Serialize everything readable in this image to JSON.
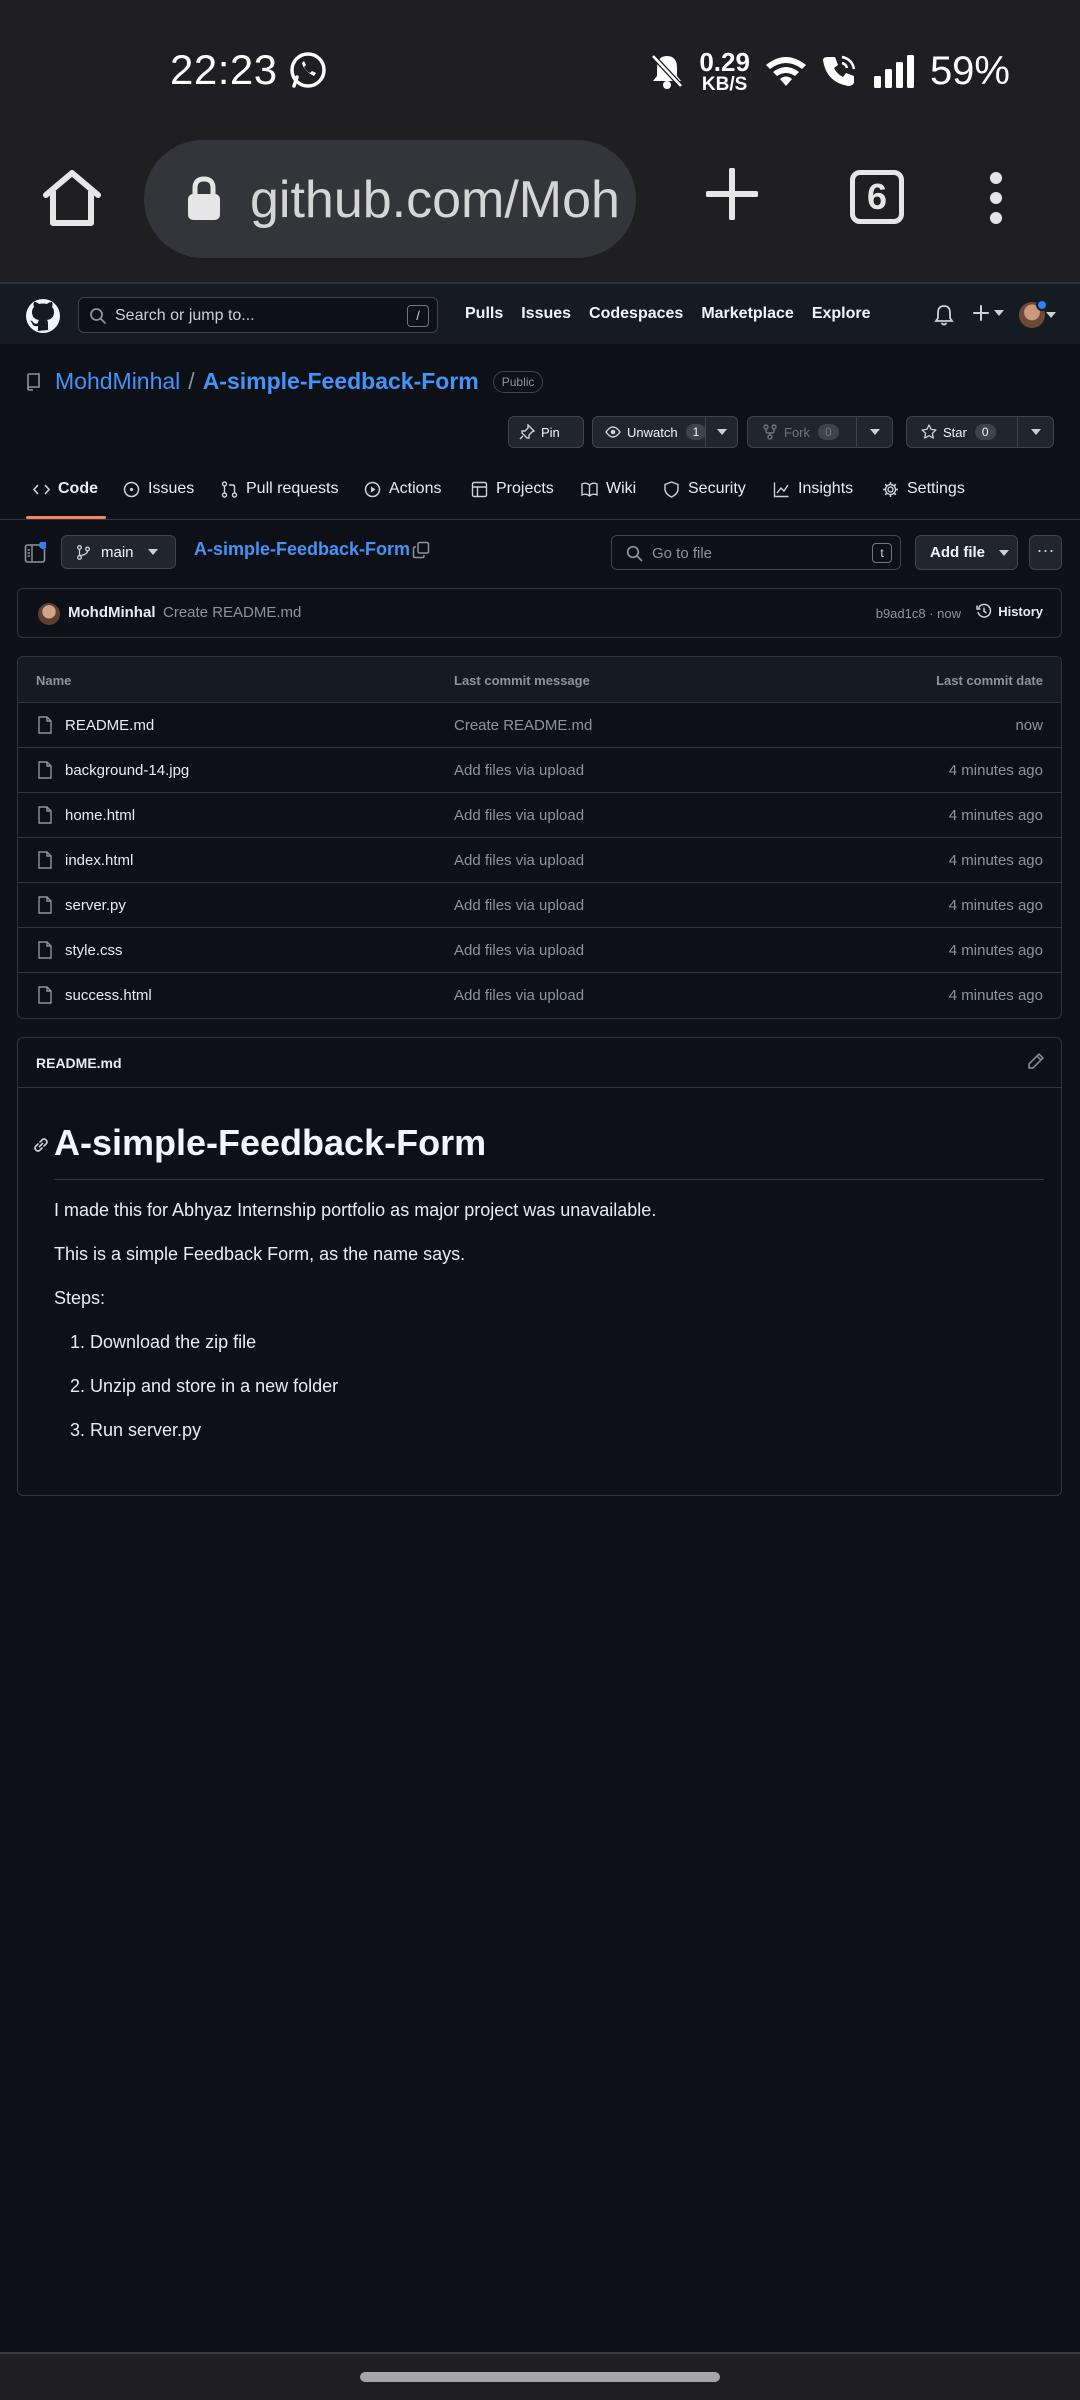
{
  "status_bar": {
    "time": "22:23",
    "net_speed_value": "0.29",
    "net_speed_unit": "KB/S",
    "battery": "59%"
  },
  "browser": {
    "url": "github.com/Moh",
    "tab_count": "6"
  },
  "github_header": {
    "search_placeholder": "Search or jump to...",
    "search_shortcut": "/",
    "nav": [
      "Pulls",
      "Issues",
      "Codespaces",
      "Marketplace",
      "Explore"
    ]
  },
  "repo": {
    "owner": "MohdMinhal",
    "separator": "/",
    "name": "A-simple-Feedback-Form",
    "visibility": "Public"
  },
  "actions": {
    "pin": "Pin",
    "unwatch": "Unwatch",
    "watch_count": "1",
    "fork": "Fork",
    "fork_count": "0",
    "star": "Star",
    "star_count": "0"
  },
  "tabs": [
    "Code",
    "Issues",
    "Pull requests",
    "Actions",
    "Projects",
    "Wiki",
    "Security",
    "Insights",
    "Settings"
  ],
  "file_nav": {
    "branch": "main",
    "repo_crumb": "A-simple-Feedback-Form",
    "goto_placeholder": "Go to file",
    "goto_shortcut": "t",
    "add_file": "Add file",
    "more": "···"
  },
  "commit": {
    "author": "MohdMinhal",
    "message": "Create README.md",
    "sha_time": "b9ad1c8 · now",
    "history": "History"
  },
  "files": {
    "headers": {
      "name": "Name",
      "message": "Last commit message",
      "date": "Last commit date"
    },
    "rows": [
      {
        "name": "README.md",
        "message": "Create README.md",
        "date": "now"
      },
      {
        "name": "background-14.jpg",
        "message": "Add files via upload",
        "date": "4 minutes ago"
      },
      {
        "name": "home.html",
        "message": "Add files via upload",
        "date": "4 minutes ago"
      },
      {
        "name": "index.html",
        "message": "Add files via upload",
        "date": "4 minutes ago"
      },
      {
        "name": "server.py",
        "message": "Add files via upload",
        "date": "4 minutes ago"
      },
      {
        "name": "style.css",
        "message": "Add files via upload",
        "date": "4 minutes ago"
      },
      {
        "name": "success.html",
        "message": "Add files via upload",
        "date": "4 minutes ago"
      }
    ]
  },
  "readme": {
    "filename": "README.md",
    "heading": "A-simple-Feedback-Form",
    "paragraphs": [
      "I made this for Abhyaz Internship portfolio as major project was unavailable.",
      "This is a simple Feedback Form, as the name says.",
      "Steps:"
    ],
    "steps": [
      "1. Download the zip file",
      "2. Unzip and store in a new folder",
      "3. Run server.py"
    ]
  },
  "colors": {
    "accent_link": "#4493f8",
    "tab_underline": "#f78166",
    "page_bg": "#0d1117"
  }
}
